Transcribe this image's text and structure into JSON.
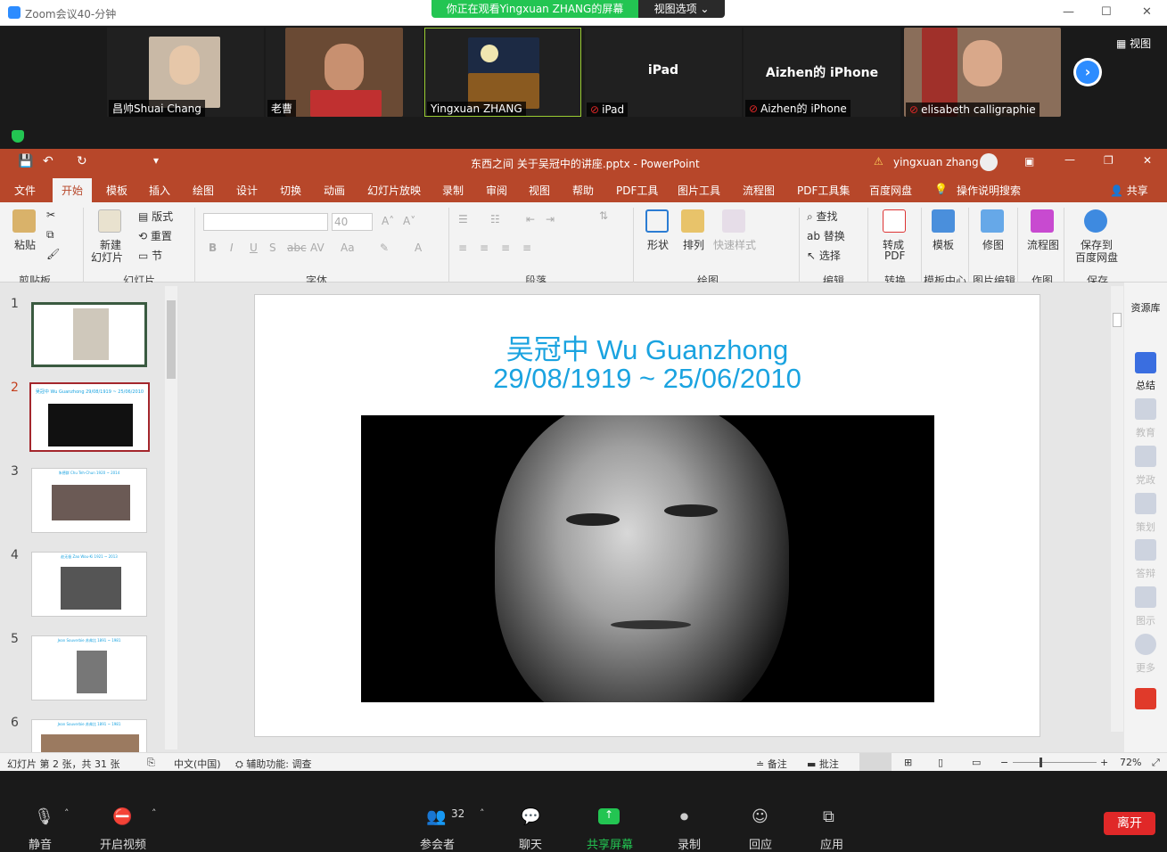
{
  "zoom": {
    "window_title": "Zoom会议40-分钟",
    "share_banner": "你正在观看Yingxuan  ZHANG的屏幕",
    "view_options": "视图选项 ⌄",
    "view_button": "视图",
    "participants": [
      {
        "name": "昌帅Shuai Chang",
        "muted": false,
        "video": true
      },
      {
        "name": "老曹",
        "muted": false,
        "video": true
      },
      {
        "name": "Yingxuan ZHANG",
        "muted": false,
        "video": true
      },
      {
        "name": "iPad",
        "muted": true,
        "video": false
      },
      {
        "name": "Aizhen的 iPhone",
        "muted": true,
        "video": false
      },
      {
        "name": "elisabeth calligraphie",
        "muted": true,
        "video": true
      }
    ],
    "controls": [
      {
        "label": "静音",
        "icon": "microphone-icon"
      },
      {
        "label": "开启视频",
        "icon": "video-off-icon"
      },
      {
        "label": "参会者",
        "icon": "participants-icon",
        "count": "32"
      },
      {
        "label": "聊天",
        "icon": "chat-icon"
      },
      {
        "label": "共享屏幕",
        "icon": "share-screen-icon"
      },
      {
        "label": "录制",
        "icon": "record-icon"
      },
      {
        "label": "回应",
        "icon": "reaction-icon"
      },
      {
        "label": "应用",
        "icon": "apps-icon"
      }
    ],
    "leave_label": "离开",
    "colors": {
      "share_green": "#23c552",
      "leave_red": "#e02828",
      "zoom_blue": "#2d8cff"
    }
  },
  "ppt": {
    "doc_title": "东西之间 关于吴冠中的讲座.pptx  -  PowerPoint",
    "user": "yingxuan zhang",
    "share_label": "共享",
    "tabs": [
      "文件",
      "开始",
      "模板",
      "插入",
      "绘图",
      "设计",
      "切换",
      "动画",
      "幻灯片放映",
      "录制",
      "审阅",
      "视图",
      "帮助",
      "PDF工具",
      "图片工具",
      "流程图",
      "PDF工具集",
      "百度网盘",
      "操作说明搜索"
    ],
    "active_tab": "开始",
    "ribbon": {
      "paste": "粘贴",
      "new_slide_1": "新建",
      "new_slide_2": "幻灯片",
      "layout": "版式",
      "reset": "重置",
      "section": "节",
      "font_size": "40",
      "shape": "形状",
      "arrange": "排列",
      "quick_style": "快速样式",
      "find": "查找",
      "replace": "替换",
      "select": "选择",
      "to_pdf_1": "转成",
      "to_pdf_2": "PDF",
      "template": "模板",
      "edit_pic": "修图",
      "flowchart": "流程图",
      "save_baidu_1": "保存到",
      "save_baidu_2": "百度网盘",
      "groups": [
        "剪贴板",
        "幻灯片",
        "字体",
        "段落",
        "绘图",
        "编辑",
        "转换",
        "模板中心",
        "图片编辑",
        "作图",
        "保存"
      ]
    },
    "thumbnails": [
      {
        "num": "1",
        "caption": ""
      },
      {
        "num": "2",
        "caption": "吴冠中 Wu Guanzhong 29/08/1919 ~ 25/06/2010"
      },
      {
        "num": "3",
        "caption": "朱德群 Chu Teh-Chun 1920 ~ 2014"
      },
      {
        "num": "4",
        "caption": "赵无极 Zao Wou-Ki 1921 ~ 2013"
      },
      {
        "num": "5",
        "caption": "Jean Souverbie 苏弗比 1891 ~ 1981"
      },
      {
        "num": "6",
        "caption": "Jean Souverbie 苏弗比 1891 ~ 1981"
      }
    ],
    "selected_slide": "2",
    "slide": {
      "title_line1": "吴冠中 Wu Guanzhong",
      "title_line2": "29/08/1919  ~  25/06/2010",
      "image": "portrait-photo"
    },
    "right_panel": {
      "header": "资源库",
      "items": [
        "总结",
        "教育",
        "党政",
        "策划",
        "答辩",
        "图示",
        "更多"
      ]
    },
    "status": {
      "slide_info": "幻灯片 第 2 张，共 31 张",
      "language": "中文(中国)",
      "accessibility": "辅助功能: 调查",
      "notes": "备注",
      "comments": "批注",
      "zoom": "72%"
    },
    "colors": {
      "accent": "#b7472a",
      "title_blue": "#1aa3e0"
    }
  }
}
